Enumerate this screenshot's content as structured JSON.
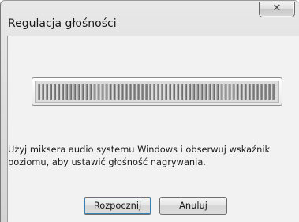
{
  "window": {
    "title": "Regulacja głośności"
  },
  "icons": {
    "close": "close-icon"
  },
  "meter": {
    "level": 0,
    "segment_count": 60
  },
  "message": "Użyj miksera audio systemu Windows i obserwuj wskaźnik poziomu, aby ustawić głośność nagrywania.",
  "buttons": {
    "start_label": "Rozpocznij",
    "cancel_label": "Anuluj"
  },
  "colors": {
    "segment": "#6e6e6e",
    "segment_highlight": "#9a9a9a",
    "default_button_ring": "#3c7fb1"
  }
}
